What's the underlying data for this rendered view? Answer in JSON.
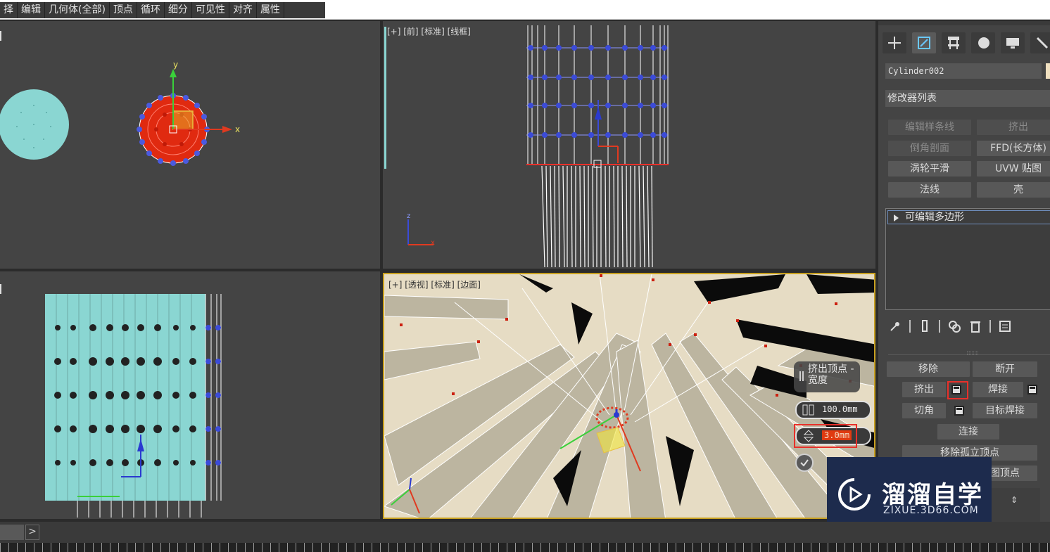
{
  "menu": {
    "items": [
      "择",
      "编辑",
      "几何体(全部)",
      "顶点",
      "循环",
      "细分",
      "可见性",
      "对齐",
      "属性"
    ]
  },
  "viewports": {
    "front": {
      "label": "[+] [前] [标准] [线框]"
    },
    "perspective": {
      "label": "[+] [透视] [标准] [边面]"
    },
    "axis": {
      "x": "x",
      "y": "y",
      "z": "z"
    }
  },
  "caddy": {
    "title": "挤出顶点 -宽度",
    "height_value": "100.0mm",
    "width_value": "3.0mm"
  },
  "panel": {
    "object_name": "Cylinder002",
    "object_color": "#f0e0c0",
    "modifier_list": "修改器列表",
    "modifier_buttons": [
      "编辑样条线",
      "挤出",
      "倒角剖面",
      "FFD(长方体)",
      "涡轮平滑",
      "UVW 贴图",
      "法线",
      "壳"
    ],
    "stack_item": "可编辑多边形",
    "edit_vertices": {
      "remove": "移除",
      "break": "断开",
      "extrude": "挤出",
      "weld": "焊接",
      "chamfer": "切角",
      "target_weld": "目标焊接",
      "connect": "连接",
      "remove_isolated": "移除孤立顶点",
      "remove_unused_map": "图顶点"
    }
  },
  "watermark": {
    "title": "溜溜自学",
    "subtitle": "ZIXUE.3D66.COM"
  },
  "statusbar": {
    "next": ">"
  },
  "colors": {
    "viewport_bg": "#444444",
    "mesh_cyan": "#8ad6d2",
    "vertex_blue": "#3b4bd8",
    "selected_red": "#e8302a",
    "highlight_yellow": "#c8a020",
    "watermark_bg": "#1d2b4d"
  }
}
